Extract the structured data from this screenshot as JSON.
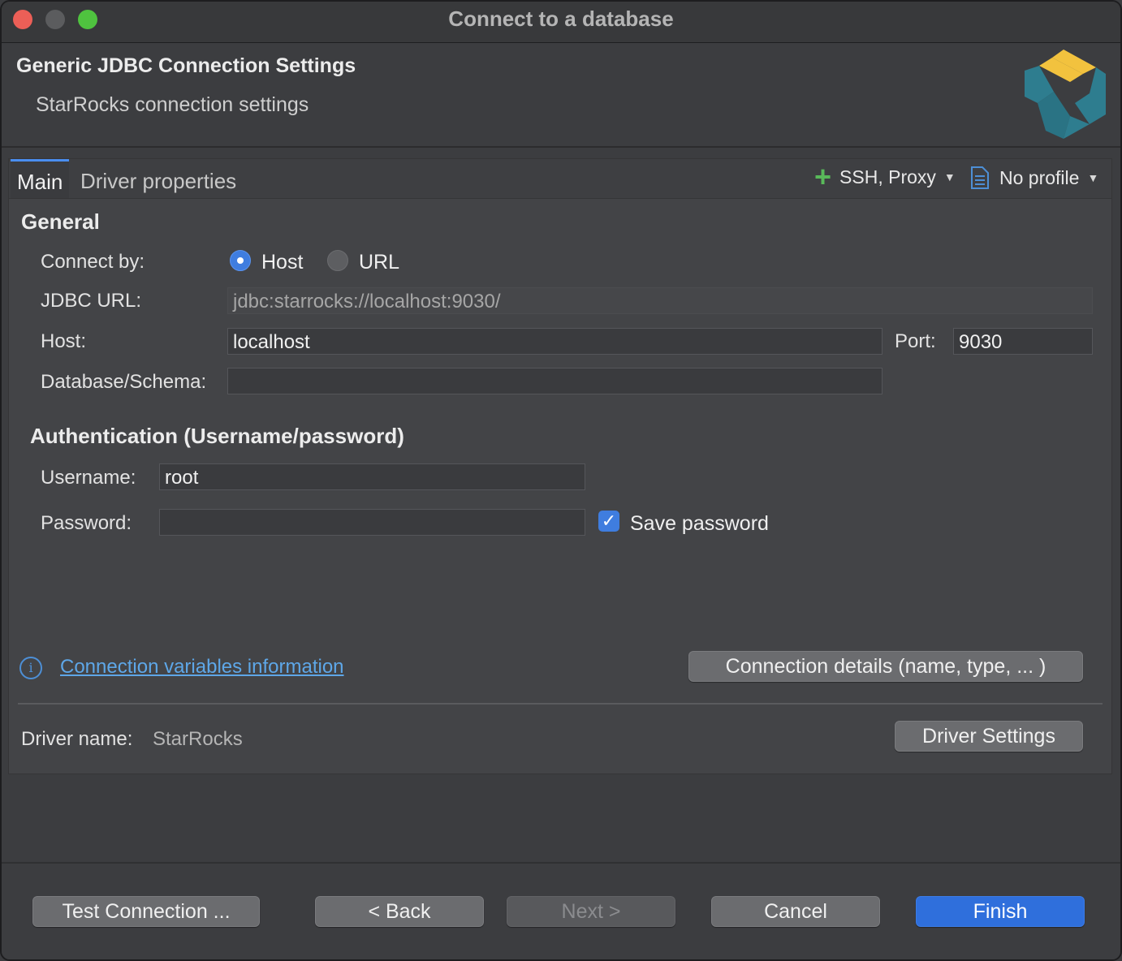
{
  "window": {
    "title": "Connect to a database"
  },
  "header": {
    "title": "Generic JDBC Connection Settings",
    "subtitle": "StarRocks connection settings",
    "logo_icon": "starrocks-logo-icon"
  },
  "tabs": [
    {
      "label": "Main",
      "active": true
    },
    {
      "label": "Driver properties",
      "active": false
    }
  ],
  "toolbar": {
    "ssh_proxy_label": "SSH, Proxy",
    "profile_label": "No profile"
  },
  "general": {
    "section_title": "General",
    "connect_by_label": "Connect by:",
    "options": [
      {
        "label": "Host",
        "selected": true
      },
      {
        "label": "URL",
        "selected": false
      }
    ],
    "jdbc_url_label": "JDBC URL:",
    "jdbc_url_value": "jdbc:starrocks://localhost:9030/",
    "host_label": "Host:",
    "host_value": "localhost",
    "port_label": "Port:",
    "port_value": "9030",
    "database_label": "Database/Schema:",
    "database_value": ""
  },
  "auth": {
    "section_title": "Authentication (Username/password)",
    "username_label": "Username:",
    "username_value": "root",
    "password_label": "Password:",
    "password_value": "",
    "save_password_label": "Save password",
    "save_password_checked": true
  },
  "links": {
    "variables_info": "Connection variables information",
    "connection_details": "Connection details (name, type, ... )"
  },
  "driver": {
    "name_label": "Driver name:",
    "name_value": "StarRocks",
    "settings_button": "Driver Settings"
  },
  "footer": {
    "test_connection": "Test Connection ...",
    "back": "< Back",
    "next": "Next >",
    "cancel": "Cancel",
    "finish": "Finish"
  },
  "colors": {
    "accent": "#2f6fdc",
    "link": "#5ea7e8",
    "add_icon": "#59b95a",
    "logo_yellow": "#f2c23e",
    "logo_teal": "#2e7d8f"
  }
}
